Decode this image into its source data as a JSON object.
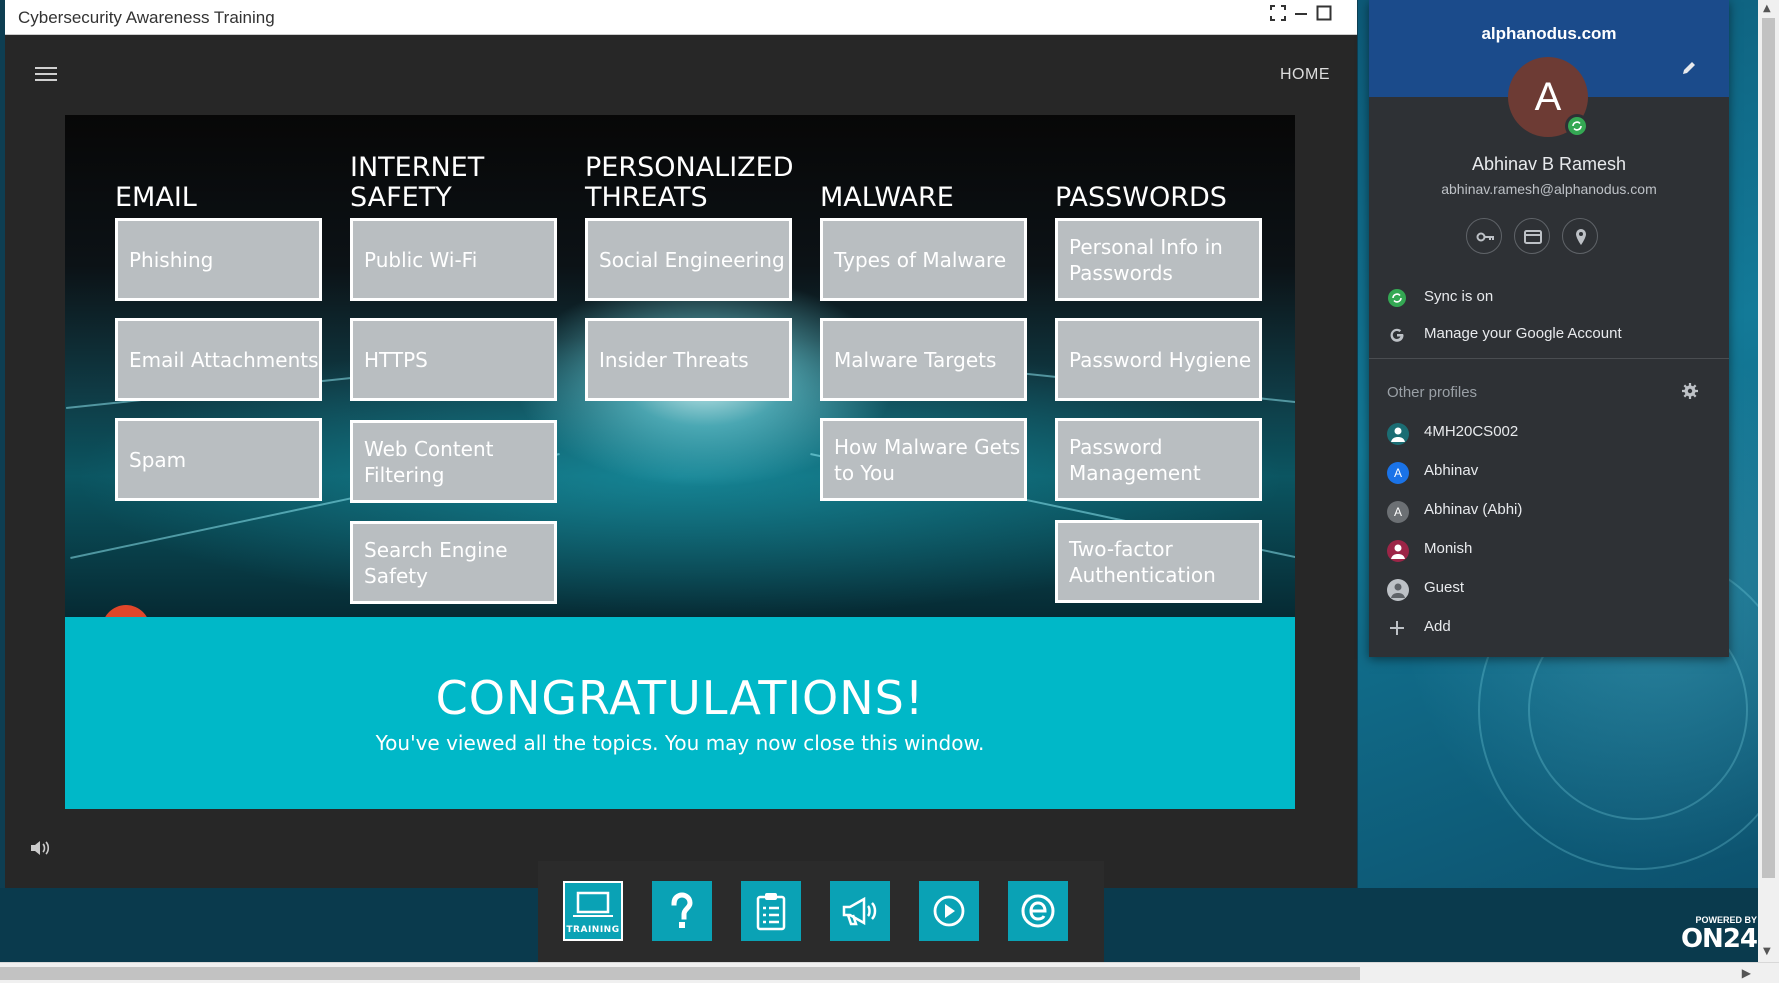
{
  "course_window": {
    "title": "Cybersecurity Awareness Training",
    "nav_home": "HOME"
  },
  "categories": [
    {
      "title": "EMAIL",
      "topics": [
        "Phishing",
        "Email Attachments",
        "Spam"
      ]
    },
    {
      "title": "INTERNET SAFETY",
      "topics": [
        "Public Wi-Fi",
        "HTTPS",
        "Web Content Filtering",
        "Search Engine Safety"
      ]
    },
    {
      "title": "PERSONALIZED THREATS",
      "topics": [
        "Social Engineering",
        "Insider Threats"
      ]
    },
    {
      "title": "MALWARE",
      "topics": [
        "Types of Malware",
        "Malware Targets",
        "How Malware Gets to You"
      ]
    },
    {
      "title": "PASSWORDS",
      "topics": [
        "Personal Info in Passwords",
        "Password Hygiene",
        "Password Management",
        "Two-factor Authentication"
      ]
    }
  ],
  "congrats": {
    "title": "CONGRATULATIONS!",
    "subtitle": "You've viewed all the topics. You may now close this window."
  },
  "toolbar": {
    "items": [
      {
        "icon": "laptop-icon",
        "label": "TRAINING",
        "active": true
      },
      {
        "icon": "question-icon",
        "label": ""
      },
      {
        "icon": "clipboard-icon",
        "label": ""
      },
      {
        "icon": "megaphone-icon",
        "label": ""
      },
      {
        "icon": "play-icon",
        "label": ""
      },
      {
        "icon": "e-logo-icon",
        "label": ""
      }
    ]
  },
  "powered_by": {
    "small": "POWERED BY",
    "logo": "ON24"
  },
  "profile": {
    "domain": "alphanodus.com",
    "avatar_letter": "A",
    "name": "Abhinav B Ramesh",
    "email": "abhinav.ramesh@alphanodus.com",
    "sync_label": "Sync is on",
    "manage_label": "Manage your Google Account",
    "other_profiles_label": "Other profiles",
    "other_profiles": [
      {
        "name": "4MH20CS002",
        "avatar": "person",
        "color": "#1b6d73"
      },
      {
        "name": "Abhinav",
        "avatar": "A",
        "color": "#1a73e8"
      },
      {
        "name": "Abhinav (Abhi)",
        "avatar": "A",
        "color": "#6c7074"
      },
      {
        "name": "Monish",
        "avatar": "person",
        "color": "#9c2547"
      },
      {
        "name": "Guest",
        "avatar": "person",
        "color": "#5f6368"
      }
    ],
    "add_label": "Add"
  },
  "colors": {
    "tile_bg": "#b9bec1",
    "accent_teal": "#00b8c8",
    "toolbar_button": "#0aa2b5",
    "popup_header": "#1b4b8b",
    "popup_bg": "#2e3135",
    "sync_green": "#34a853"
  }
}
